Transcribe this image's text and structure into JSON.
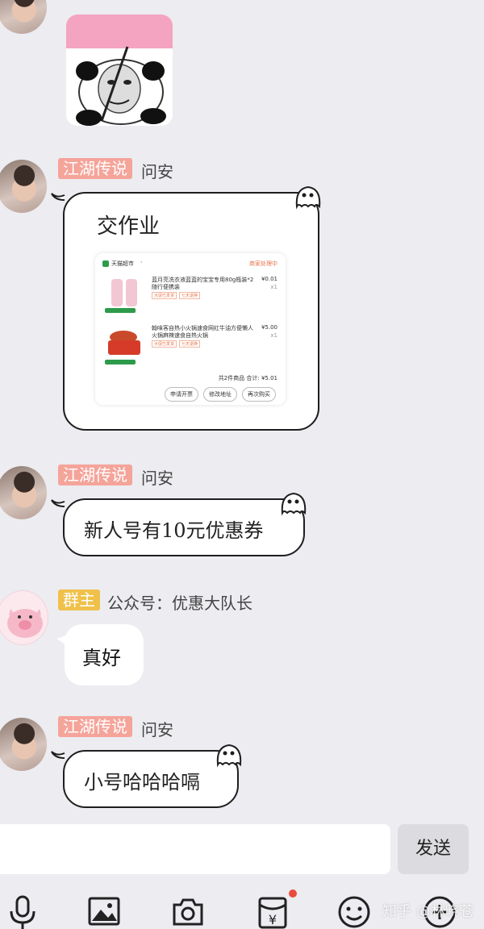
{
  "messages": [
    {
      "badge": "江湖传说",
      "name": "问安",
      "text": "交作业"
    },
    {
      "badge": "江湖传说",
      "name": "问安",
      "text": "新人号有10元优惠券"
    },
    {
      "badge": "群主",
      "name": "公众号：优惠大队长",
      "text": "真好"
    },
    {
      "badge": "江湖传说",
      "name": "问安",
      "text": "小号哈哈哈嗝"
    }
  ],
  "order_card": {
    "store": "天猫超市",
    "status": "商家处理中",
    "items": [
      {
        "title": "蓝月亮洗衣液蓝蓝的宝宝专用80g瓶装*2",
        "title2": "随行便携装",
        "price": "¥0.01",
        "qty": "x1",
        "tag1": "大促已发货",
        "tag2": "七天退换",
        "badge": "天猫超市"
      },
      {
        "title": "翰味客自热小火锅速食网红牛油方便懒人",
        "title2": "火锅麻辣速食自热火锅",
        "price": "¥5.00",
        "qty": "x1",
        "tag1": "大促已发货",
        "tag2": "七天退换",
        "badge": "天猫超市"
      }
    ],
    "total": "共2件商品  合计: ¥5.01",
    "buttons": [
      "申请开票",
      "修改地址",
      "再次购买"
    ]
  },
  "input": {
    "value": "",
    "send_label": "发送"
  },
  "toolbar": {
    "icons": [
      "microphone-icon",
      "image-icon",
      "camera-icon",
      "red-packet-icon",
      "emoji-icon",
      "plus-icon"
    ],
    "notification_color": "#e94b3c"
  },
  "watermark": "知乎 @林晓苍",
  "colors": {
    "badge_red": "#f5a49a",
    "badge_gold": "#f0c14a",
    "background": "#ececf1"
  }
}
